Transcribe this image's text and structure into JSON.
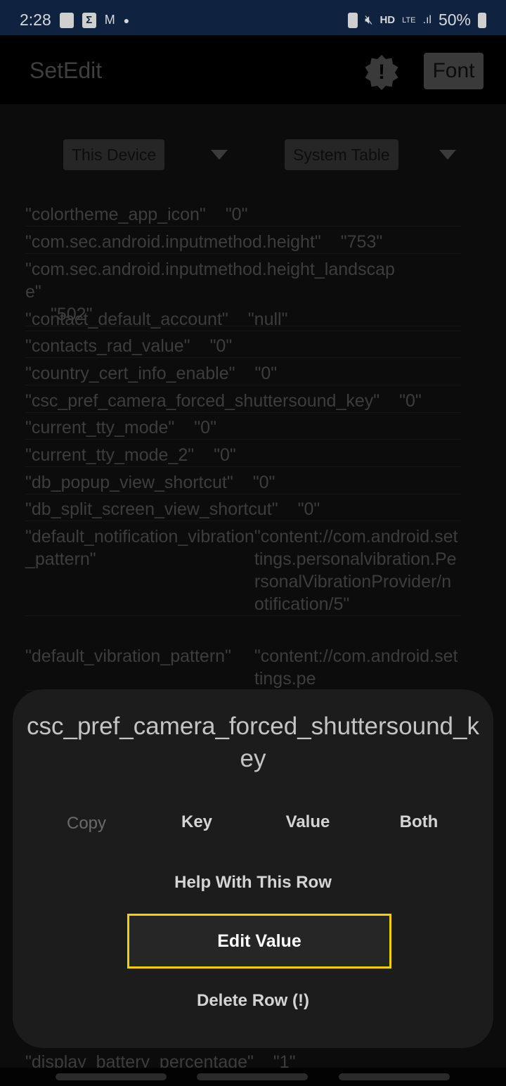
{
  "status_bar": {
    "time": "2:28",
    "battery": "50%",
    "icons": [
      "image-icon",
      "sigma-icon",
      "gmail-icon",
      "dot-icon",
      "battery-saver-icon",
      "mute-icon",
      "hd-voice-icon",
      "lte-icon",
      "signal-icon",
      "battery-icon"
    ],
    "m": "M",
    "hd": "HD",
    "lte": "LTE"
  },
  "app_bar": {
    "title": "SetEdit",
    "alert_glyph": "!",
    "font_label": "Font"
  },
  "selectors": {
    "device": "This Device",
    "table": "System Table"
  },
  "rows": [
    {
      "key": "\"colortheme_app_icon\"",
      "value": "\"0\""
    },
    {
      "key": "\"com.sec.android.inputmethod.height\"",
      "value": "\"753\""
    },
    {
      "key": "\"com.sec.android.inputmethod.height_landscape\"",
      "value": "\"502\""
    },
    {
      "key": "\"contact_default_account\"",
      "value": "\"null\""
    },
    {
      "key": "\"contacts_rad_value\"",
      "value": "\"0\""
    },
    {
      "key": "\"country_cert_info_enable\"",
      "value": "\"0\""
    },
    {
      "key": "\"csc_pref_camera_forced_shuttersound_key\"",
      "value": "\"0\""
    },
    {
      "key": "\"current_tty_mode\"",
      "value": "\"0\""
    },
    {
      "key": "\"current_tty_mode_2\"",
      "value": "\"0\""
    },
    {
      "key": "\"db_popup_view_shortcut\"",
      "value": "\"0\""
    },
    {
      "key": "\"db_split_screen_view_shortcut\"",
      "value": "\"0\""
    },
    {
      "key": "\"default_notification_vibration_pattern\"",
      "value": "\"content://com.android.settings.personalvibration.PersonalVibrationProvider/notification/5\""
    },
    {
      "key": "\"default_vibration_pattern\"",
      "value": "\"content://com.android.settings.pe"
    },
    {
      "key": "\"display_battery_percentage\"",
      "value": "\"1\""
    }
  ],
  "dialog": {
    "title": "csc_pref_camera_forced_shuttersound_key",
    "copy_label": "Copy",
    "key_label": "Key",
    "value_label": "Value",
    "both_label": "Both",
    "help": "Help With This Row",
    "edit": "Edit Value",
    "delete": "Delete Row (!)",
    "highlight_color": "#f5d000"
  }
}
